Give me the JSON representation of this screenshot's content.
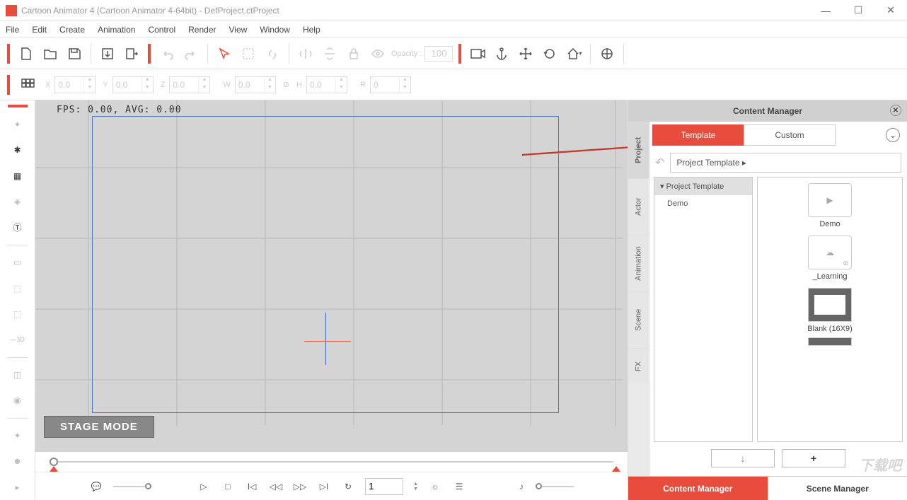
{
  "title": "Cartoon Animator 4  (Cartoon Animator 4-64bit) - DefProject.ctProject",
  "menu": [
    "File",
    "Edit",
    "Create",
    "Animation",
    "Control",
    "Render",
    "View",
    "Window",
    "Help"
  ],
  "toolbar": {
    "opacity_label": "Opacity :",
    "opacity_value": "100"
  },
  "props": {
    "x": "0.0",
    "y": "0.0",
    "z": "0.0",
    "w": "0.0",
    "h": "0.0",
    "r": "0",
    "xl": "X",
    "yl": "Y",
    "zl": "Z",
    "wl": "W",
    "hl": "H",
    "rl": "R"
  },
  "stage": {
    "fps": "FPS: 0.00, AVG: 0.00",
    "mode": "STAGE MODE"
  },
  "playbar": {
    "frame": "1"
  },
  "content_manager": {
    "title": "Content Manager",
    "tabs": {
      "template": "Template",
      "custom": "Custom"
    },
    "vtabs": [
      "Project",
      "Actor",
      "Animation",
      "Scene",
      "FX"
    ],
    "breadcrumb": "Project Template ▸",
    "tree_header": "Project Template",
    "tree_items": [
      "Demo"
    ],
    "thumbs": [
      {
        "label": "Demo",
        "kind": "play"
      },
      {
        "label": "_Learning",
        "kind": "cloud"
      },
      {
        "label": "Blank (16X9)",
        "kind": "blank"
      }
    ],
    "download_btn": "↓",
    "add_btn": "+",
    "bottom_tabs": {
      "cm": "Content Manager",
      "sm": "Scene Manager"
    }
  },
  "watermark": "下载吧"
}
